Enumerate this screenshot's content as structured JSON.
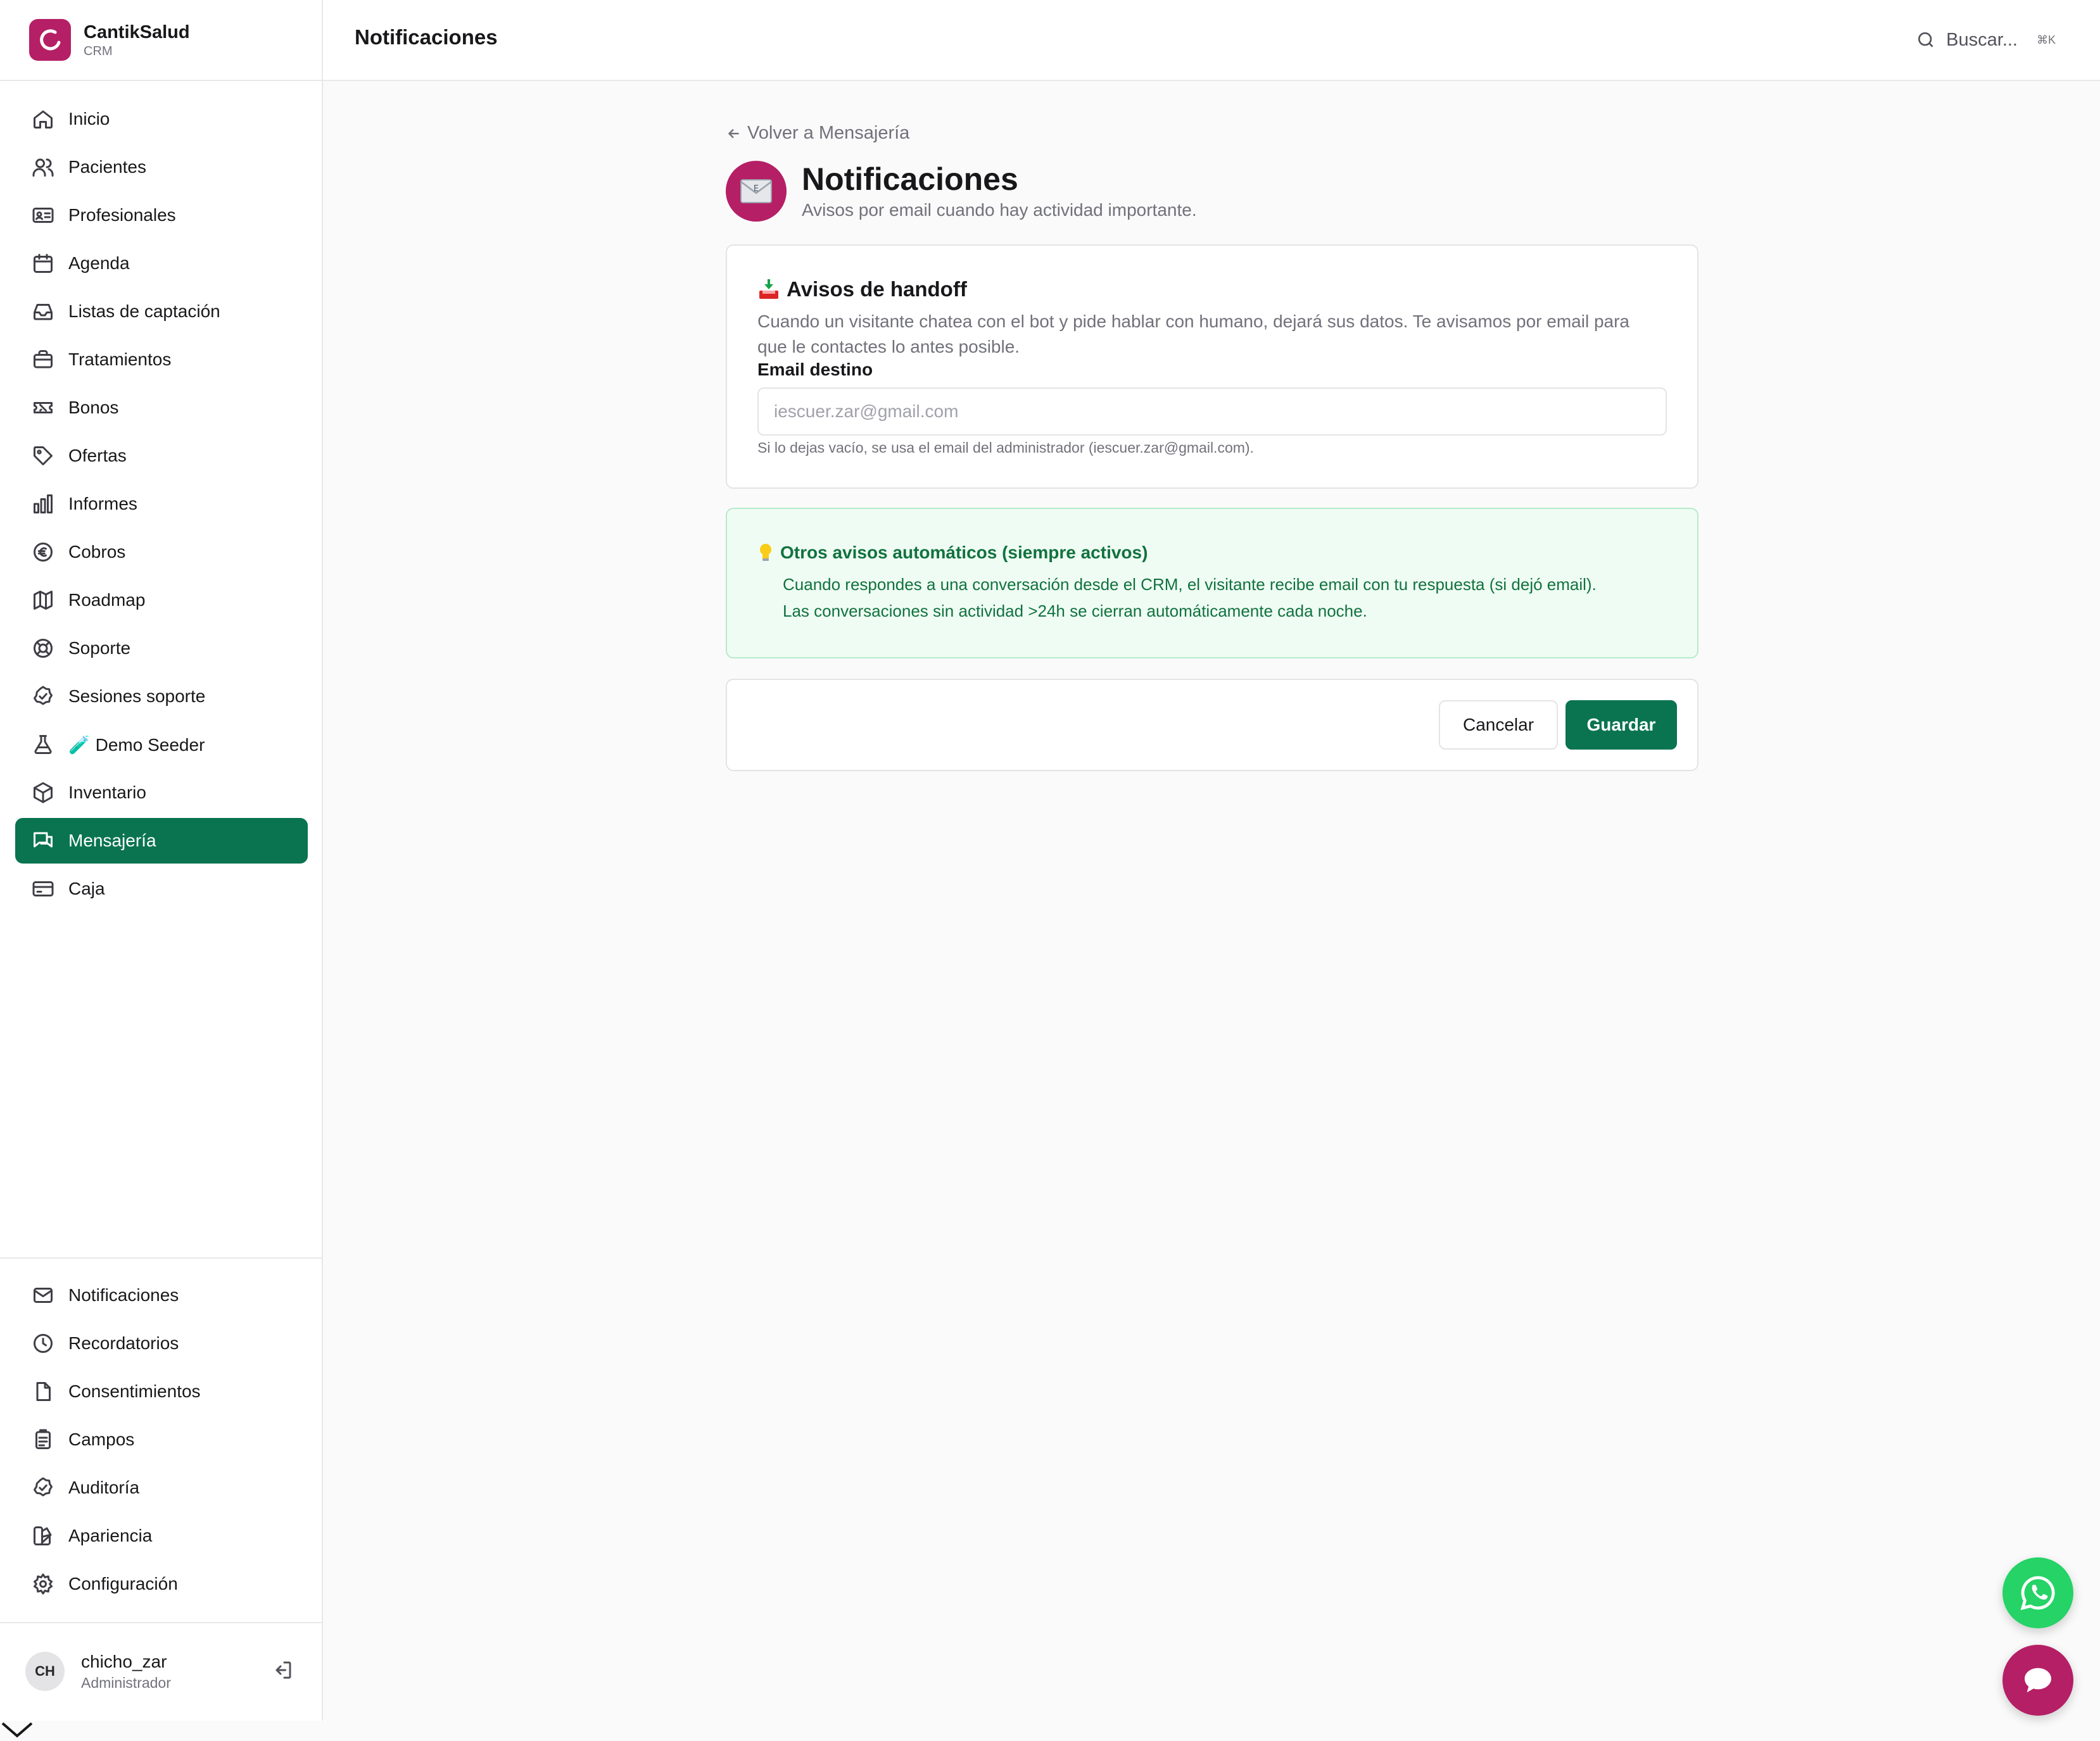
{
  "brand": {
    "name": "CantikSalud",
    "sub": "CRM",
    "color": "#b51f66"
  },
  "topbar": {
    "title": "Notificaciones",
    "search_label": "Buscar...",
    "search_kbd": "⌘K"
  },
  "sidebar": {
    "items": [
      {
        "label": "Inicio",
        "icon": "home-icon"
      },
      {
        "label": "Pacientes",
        "icon": "users-icon"
      },
      {
        "label": "Profesionales",
        "icon": "id-card-icon"
      },
      {
        "label": "Agenda",
        "icon": "calendar-icon"
      },
      {
        "label": "Listas de captación",
        "icon": "inbox-icon"
      },
      {
        "label": "Tratamientos",
        "icon": "briefcase-icon"
      },
      {
        "label": "Bonos",
        "icon": "ticket-icon"
      },
      {
        "label": "Ofertas",
        "icon": "tag-icon"
      },
      {
        "label": "Informes",
        "icon": "bar-chart-icon"
      },
      {
        "label": "Cobros",
        "icon": "euro-icon"
      },
      {
        "label": "Roadmap",
        "icon": "map-icon"
      },
      {
        "label": "Soporte",
        "icon": "lifebuoy-icon"
      },
      {
        "label": "Sesiones soporte",
        "icon": "check-badge-icon"
      },
      {
        "label": "🧪 Demo Seeder",
        "icon": "flask-icon"
      },
      {
        "label": "Inventario",
        "icon": "box-icon"
      },
      {
        "label": "Mensajería",
        "icon": "messages-icon",
        "active": true
      },
      {
        "label": "Caja",
        "icon": "credit-card-icon"
      }
    ],
    "bottom_items": [
      {
        "label": "Notificaciones",
        "icon": "mail-icon"
      },
      {
        "label": "Recordatorios",
        "icon": "clock-icon"
      },
      {
        "label": "Consentimientos",
        "icon": "file-icon"
      },
      {
        "label": "Campos",
        "icon": "clipboard-icon"
      },
      {
        "label": "Auditoría",
        "icon": "check-badge-icon"
      },
      {
        "label": "Apariencia",
        "icon": "palette-icon"
      },
      {
        "label": "Configuración",
        "icon": "gear-icon"
      }
    ]
  },
  "user": {
    "initials": "CH",
    "name": "chicho_zar",
    "role": "Administrador"
  },
  "page": {
    "back_label": "Volver a Mensajería",
    "title": "Notificaciones",
    "subtitle": "Avisos por email cuando hay actividad importante."
  },
  "handoff": {
    "title": "Avisos de handoff",
    "description": "Cuando un visitante chatea con el bot y pide hablar con humano, dejará sus datos. Te avisamos por email para que le contactes lo antes posible.",
    "email_label": "Email destino",
    "email_value": "",
    "email_placeholder": "iescuer.zar@gmail.com",
    "help": "Si lo dejas vacío, se usa el email del administrador (iescuer.zar@gmail.com)."
  },
  "auto_notices": {
    "title": "Otros avisos automáticos (siempre activos)",
    "lines": [
      "Cuando respondes a una conversación desde el CRM, el visitante recibe email con tu respuesta (si dejó email).",
      "Las conversaciones sin actividad >24h se cierran automáticamente cada noche."
    ]
  },
  "actions": {
    "cancel_label": "Cancelar",
    "save_label": "Guardar"
  },
  "colors": {
    "accent_green": "#0a7450",
    "brand_magenta": "#b51f66",
    "whatsapp_green": "#25d366"
  }
}
